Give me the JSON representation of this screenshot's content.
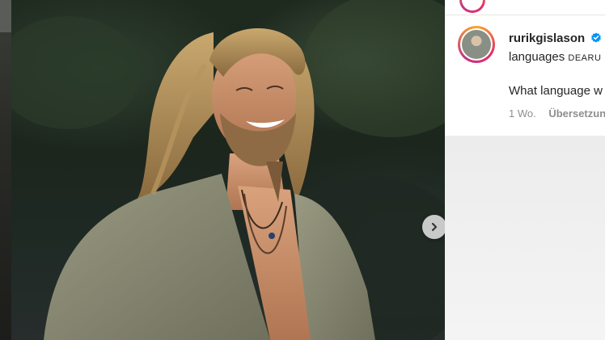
{
  "post": {
    "next_icon": "chevron-right-icon"
  },
  "comment": {
    "username": "rurikgislason",
    "caption_text": "languages",
    "caption_mention": "DEARU",
    "question": "What language w",
    "time_ago": "1 Wo.",
    "translate_label": "Übersetzun"
  },
  "colors": {
    "verified": "#0095f6",
    "text": "#262626",
    "muted": "#8e8e8e"
  }
}
